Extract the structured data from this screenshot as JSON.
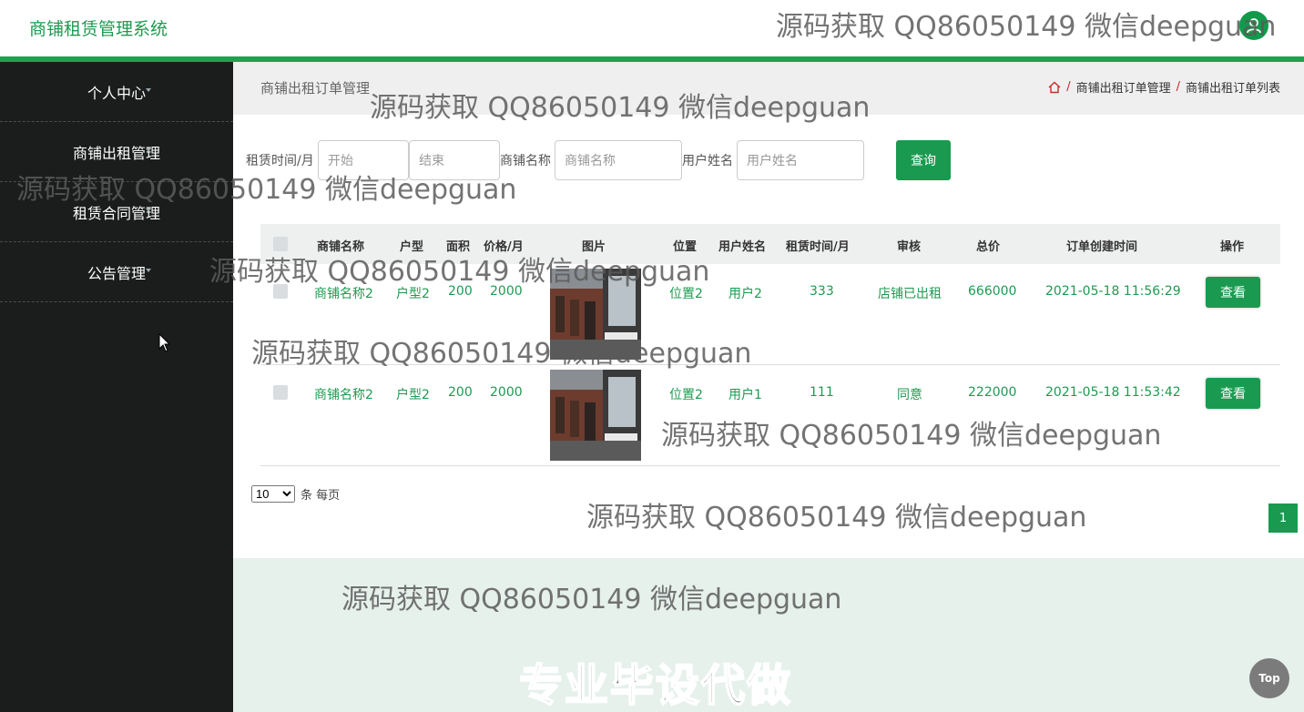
{
  "app": {
    "title": "商铺租赁管理系统"
  },
  "sidebar": {
    "items": [
      {
        "label": "个人中心"
      },
      {
        "label": "商铺出租管理"
      },
      {
        "label": "租赁合同管理"
      },
      {
        "label": "公告管理"
      }
    ]
  },
  "page": {
    "title": "商铺出租订单管理",
    "breadcrumb": [
      "商铺出租订单管理",
      "商铺出租订单列表"
    ]
  },
  "search": {
    "label_time": "租赁时间/月",
    "start_placeholder": "开始",
    "end_placeholder": "结束",
    "label_shop": "商铺名称",
    "shop_placeholder": "商铺名称",
    "label_user": "用户姓名",
    "user_placeholder": "用户姓名",
    "button": "查询"
  },
  "table": {
    "columns": [
      "商铺名称",
      "户型",
      "面积",
      "价格/月",
      "图片",
      "位置",
      "用户姓名",
      "租赁时间/月",
      "审核",
      "总价",
      "订单创建时间",
      "操作"
    ],
    "rows": [
      {
        "shop": "商铺名称2",
        "type": "户型2",
        "area": "200",
        "price": "2000",
        "location": "位置2",
        "user": "用户2",
        "months": "333",
        "status": "店铺已出租",
        "total": "666000",
        "created": "2021-05-18 11:56:29",
        "action": "查看"
      },
      {
        "shop": "商铺名称2",
        "type": "户型2",
        "area": "200",
        "price": "2000",
        "location": "位置2",
        "user": "用户1",
        "months": "111",
        "status": "同意",
        "total": "222000",
        "created": "2021-05-18 11:53:42",
        "action": "查看"
      }
    ]
  },
  "pager": {
    "page_size": "10",
    "page_size_label": "条 每页",
    "current_page": "1"
  },
  "footer": {
    "promo": "专业毕设代做",
    "top_button": "Top"
  },
  "watermark": "源码获取 QQ86050149 微信deepguan",
  "colors": {
    "accent": "#1a9a50",
    "sidebar": "#1b1d1c",
    "footer": "#e6f1ec"
  }
}
